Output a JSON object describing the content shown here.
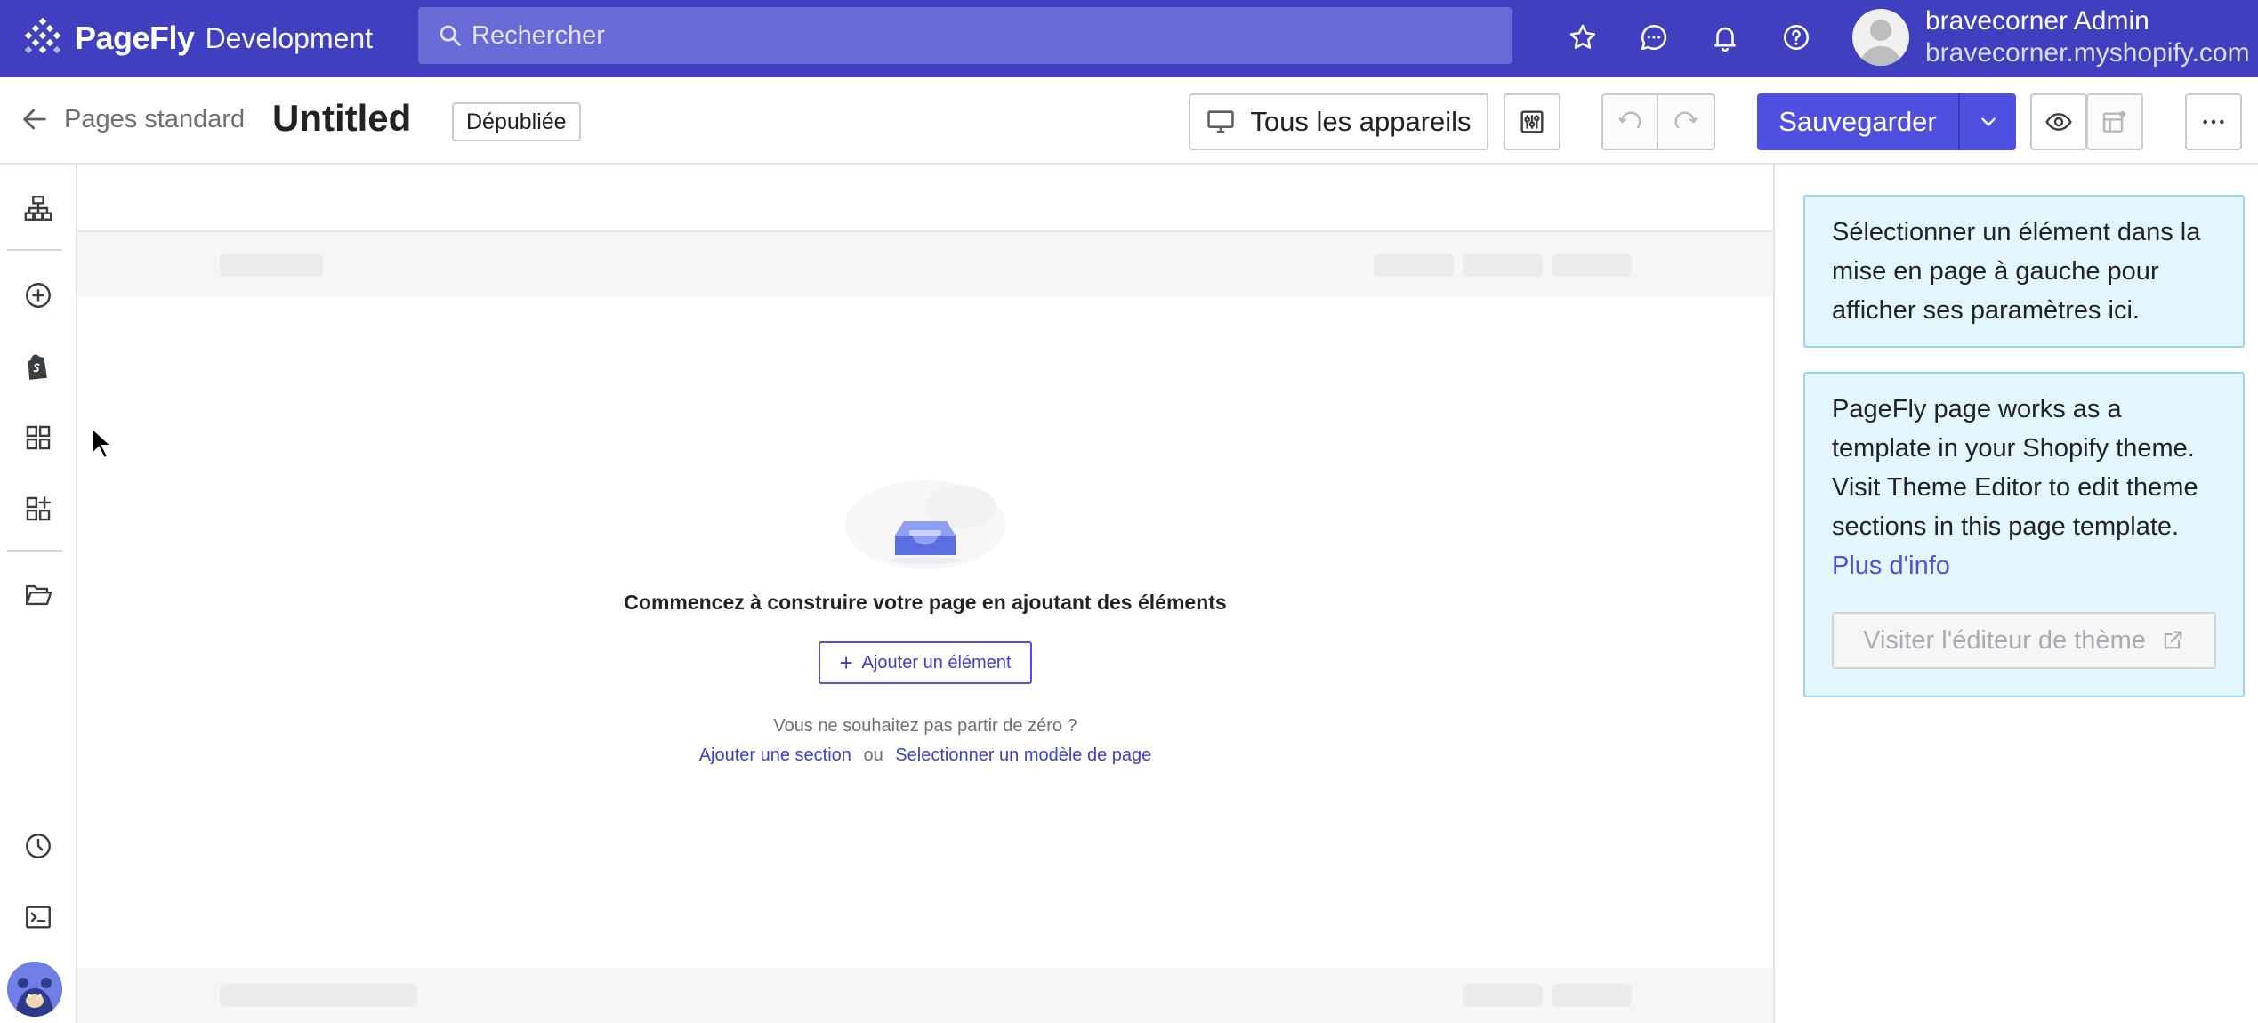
{
  "topbar": {
    "brand_main": "PageFly",
    "brand_sub": "Development",
    "search_placeholder": "Rechercher",
    "user_name": "bravecorner Admin",
    "user_shop": "bravecorner.myshopify.com"
  },
  "header": {
    "back_label": "Pages standard",
    "page_title": "Untitled",
    "status": "Dépubliée",
    "devices_label": "Tous les appareils",
    "save_label": "Sauvegarder"
  },
  "canvas": {
    "empty_title": "Commencez à construire votre page en ajoutant des éléments",
    "add_element_label": "Ajouter un élément",
    "hint": "Vous ne souhaitez pas partir de zéro ?",
    "link_add_section": "Ajouter une section",
    "or": "ou",
    "link_select_template": "Selectionner un modèle de page"
  },
  "panel": {
    "select_info": "Sélectionner un élément dans la mise en page à gauche pour afficher ses paramètres ici.",
    "template_info": "PageFly page works as a template in your Shopify theme. Visit Theme Editor to edit theme sections in this page template.",
    "more_info_link": "Plus d'info",
    "visit_theme_editor": "Visiter l'éditeur de thème"
  },
  "colors": {
    "topbar": "#3f3fbf",
    "accent": "#4f4fe0",
    "info_bg": "#e4f6fd"
  },
  "icons": {
    "rail": [
      "sitemap-icon",
      "add-circle-icon",
      "shopify-bag-icon",
      "grid-icon",
      "apps-add-icon",
      "folder-open-icon",
      "clock-icon",
      "terminal-icon"
    ]
  }
}
